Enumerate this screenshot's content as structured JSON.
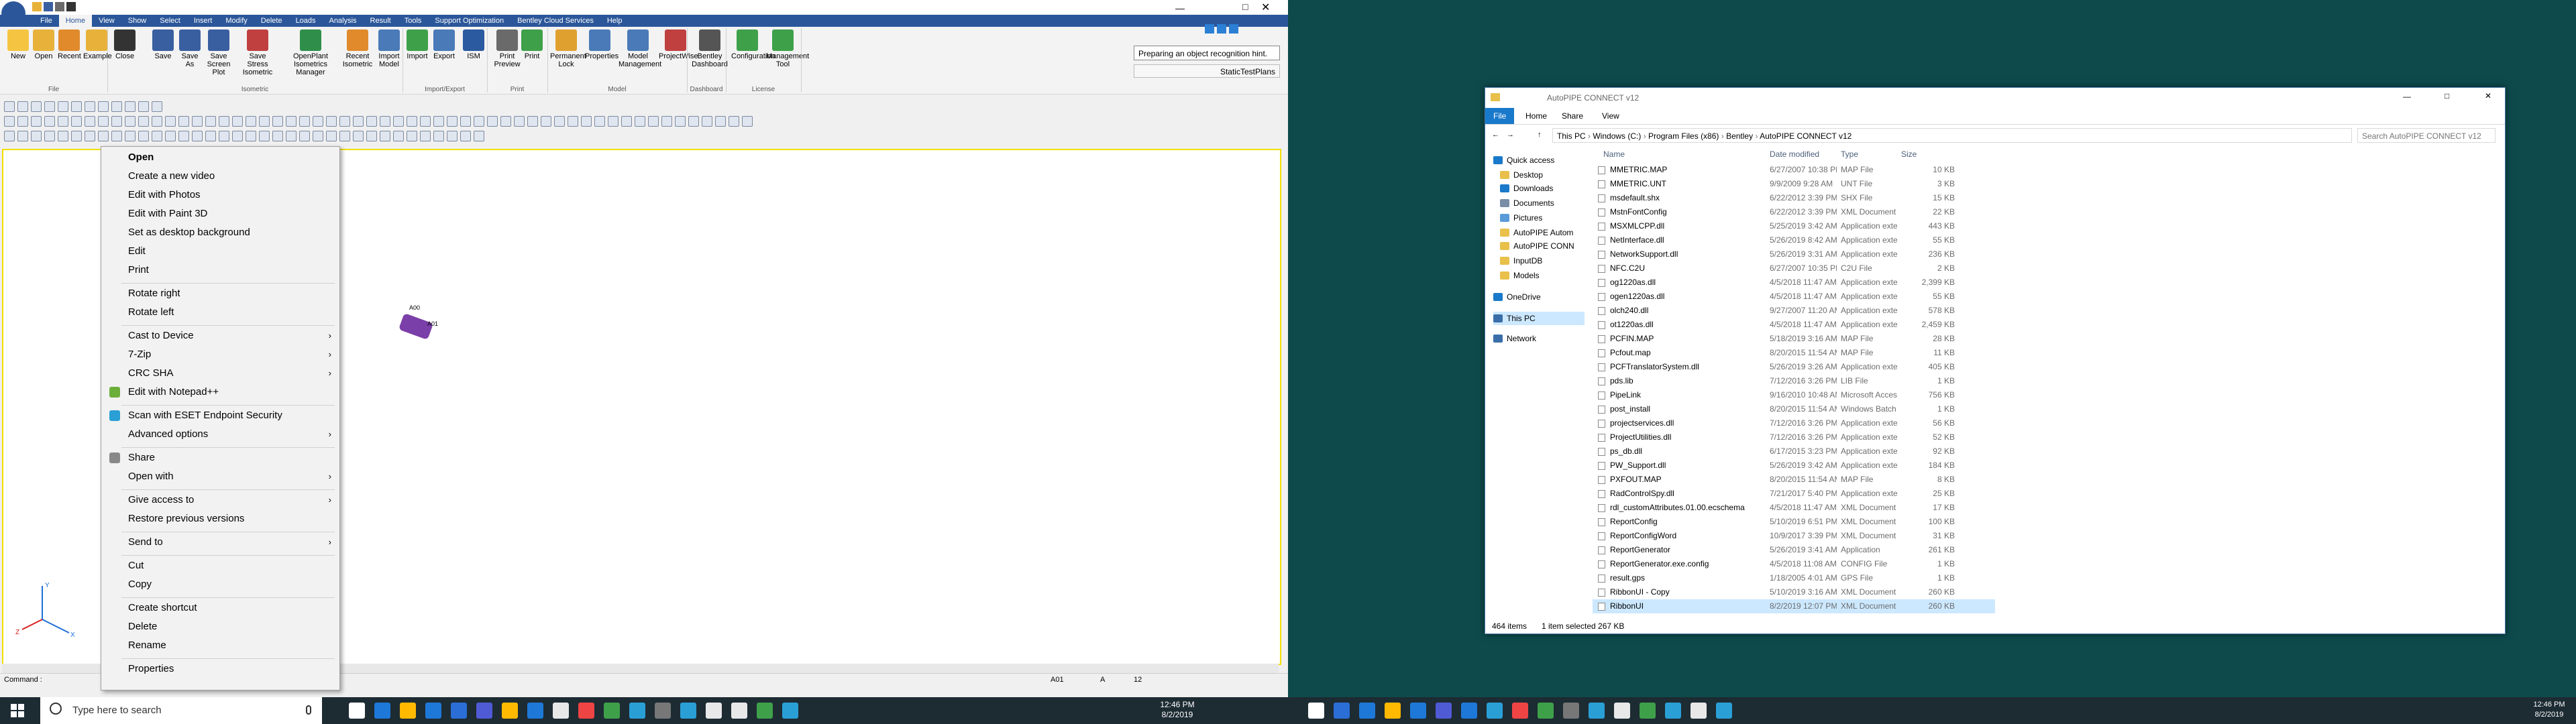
{
  "autopipe": {
    "tabs": [
      "File",
      "Home",
      "View",
      "Show",
      "Select",
      "Insert",
      "Modify",
      "Delete",
      "Loads",
      "Analysis",
      "Result",
      "Tools",
      "Support Optimization",
      "Bentley Cloud Services",
      "Help"
    ],
    "active_tab": "Home",
    "ribbon_buttons": [
      {
        "label": "New",
        "color": "#f5c542"
      },
      {
        "label": "Open",
        "color": "#e8b23a"
      },
      {
        "label": "Recent",
        "color": "#e08a2c"
      },
      {
        "label": "Example",
        "color": "#e8b23a"
      },
      {
        "label": "Close",
        "color": "#333333"
      },
      {
        "label": "Save",
        "color": "#3a5fa0"
      },
      {
        "label": "Save As",
        "color": "#3a5fa0"
      },
      {
        "label": "Save Screen Plot",
        "color": "#3a5fa0"
      },
      {
        "label": "Save Stress Isometric",
        "color": "#c04040"
      },
      {
        "label": "OpenPlant Isometrics Manager",
        "color": "#2f8f4a"
      },
      {
        "label": "Recent Isometric",
        "color": "#e08a2c"
      },
      {
        "label": "Import Model",
        "color": "#4a7ab8"
      },
      {
        "label": "Import",
        "color": "#3fa04a"
      },
      {
        "label": "Export",
        "color": "#4a7ab8"
      },
      {
        "label": "ISM",
        "color": "#2b5aa0"
      },
      {
        "label": "Print Preview",
        "color": "#6a6a6a"
      },
      {
        "label": "Print",
        "color": "#3fa04a"
      },
      {
        "label": "Permanent Lock",
        "color": "#e0a030"
      },
      {
        "label": "Properties",
        "color": "#4a7ab8"
      },
      {
        "label": "Model Management",
        "color": "#4a7ab8"
      },
      {
        "label": "ProjectWise",
        "color": "#c04040"
      },
      {
        "label": "Bentley Dashboard",
        "color": "#555555"
      },
      {
        "label": "Configuration",
        "color": "#3fa04a"
      },
      {
        "label": "Management Tool",
        "color": "#3fa04a"
      }
    ],
    "groups": [
      "File",
      "Isometric",
      "Import/Export",
      "Print",
      "Model",
      "Dashboard",
      "License"
    ],
    "hint_text": "Preparing an object recognition hint.",
    "hint_sub": "StaticTestPlans",
    "model_labels": {
      "node_a": "A00",
      "node_b": "A01"
    },
    "status": {
      "command": "Command :",
      "coord_a": "A01",
      "coord_b": "A",
      "coord_c": "12"
    }
  },
  "context_menu": {
    "items": [
      {
        "label": "Open",
        "bold": true
      },
      {
        "label": "Create a new video"
      },
      {
        "label": "Edit with Photos"
      },
      {
        "label": "Edit with Paint 3D"
      },
      {
        "label": "Set as desktop background"
      },
      {
        "label": "Edit"
      },
      {
        "label": "Print"
      },
      {
        "sep": true
      },
      {
        "label": "Rotate right"
      },
      {
        "label": "Rotate left"
      },
      {
        "sep": true
      },
      {
        "label": "Cast to Device",
        "submenu": true
      },
      {
        "label": "7-Zip",
        "submenu": true
      },
      {
        "label": "CRC SHA",
        "submenu": true
      },
      {
        "label": "Edit with Notepad++",
        "icon": "notepad-icon"
      },
      {
        "sep": true
      },
      {
        "label": "Scan with ESET Endpoint Security",
        "icon": "eset-icon"
      },
      {
        "label": "Advanced options",
        "submenu": true
      },
      {
        "sep": true
      },
      {
        "label": "Share",
        "icon": "share-icon"
      },
      {
        "label": "Open with",
        "submenu": true
      },
      {
        "sep": true
      },
      {
        "label": "Give access to",
        "submenu": true
      },
      {
        "label": "Restore previous versions"
      },
      {
        "sep": true
      },
      {
        "label": "Send to",
        "submenu": true
      },
      {
        "sep": true
      },
      {
        "label": "Cut"
      },
      {
        "label": "Copy"
      },
      {
        "sep": true
      },
      {
        "label": "Create shortcut"
      },
      {
        "label": "Delete"
      },
      {
        "label": "Rename"
      },
      {
        "sep": true
      },
      {
        "label": "Properties"
      }
    ]
  },
  "taskbar": {
    "search_placeholder": "Type here to search",
    "time": "12:46 PM",
    "date": "8/2/2019"
  },
  "explorer": {
    "title": "AutoPIPE CONNECT v12",
    "tabs": [
      "File",
      "Home",
      "Share",
      "View"
    ],
    "breadcrumb": [
      "This PC",
      "Windows (C:)",
      "Program Files (x86)",
      "Bentley",
      "AutoPIPE CONNECT v12"
    ],
    "search_placeholder": "Search AutoPIPE CONNECT v12",
    "columns": [
      "Name",
      "Date modified",
      "Type",
      "Size"
    ],
    "nav": [
      {
        "label": "Quick access",
        "icon": "star-icon"
      },
      {
        "label": "Desktop",
        "icon": "folder-icon"
      },
      {
        "label": "Downloads",
        "icon": "download-icon"
      },
      {
        "label": "Documents",
        "icon": "document-icon"
      },
      {
        "label": "Pictures",
        "icon": "picture-icon"
      },
      {
        "label": "AutoPIPE Autom",
        "icon": "folder-icon"
      },
      {
        "label": "AutoPIPE CONN",
        "icon": "folder-icon"
      },
      {
        "label": "InputDB",
        "icon": "folder-icon"
      },
      {
        "label": "Models",
        "icon": "folder-icon"
      },
      {
        "label": "OneDrive",
        "icon": "cloud-icon"
      },
      {
        "label": "This PC",
        "icon": "pc-icon"
      },
      {
        "label": "Network",
        "icon": "network-icon"
      }
    ],
    "files": [
      [
        "MMETRIC.MAP",
        "6/27/2007 10:38 PM",
        "MAP File",
        "10 KB"
      ],
      [
        "MMETRIC.UNT",
        "9/9/2009 9:28 AM",
        "UNT File",
        "3 KB"
      ],
      [
        "msdefault.shx",
        "6/22/2012 3:39 PM",
        "SHX File",
        "15 KB"
      ],
      [
        "MstnFontConfig",
        "6/22/2012 3:39 PM",
        "XML Document",
        "22 KB"
      ],
      [
        "MSXMLCPP.dll",
        "5/25/2019 3:42 AM",
        "Application exten...",
        "443 KB"
      ],
      [
        "NetInterface.dll",
        "5/26/2019 8:42 AM",
        "Application exten...",
        "55 KB"
      ],
      [
        "NetworkSupport.dll",
        "5/26/2019 3:31 AM",
        "Application exten...",
        "236 KB"
      ],
      [
        "NFC.C2U",
        "6/27/2007 10:35 PM",
        "C2U File",
        "2 KB"
      ],
      [
        "og1220as.dll",
        "4/5/2018 11:47 AM",
        "Application exten...",
        "2,399 KB"
      ],
      [
        "ogen1220as.dll",
        "4/5/2018 11:47 AM",
        "Application exten...",
        "55 KB"
      ],
      [
        "olch240.dll",
        "9/27/2007 11:20 AM",
        "Application exten...",
        "578 KB"
      ],
      [
        "ot1220as.dll",
        "4/5/2018 11:47 AM",
        "Application exten...",
        "2,459 KB"
      ],
      [
        "PCFIN.MAP",
        "5/18/2019 3:16 AM",
        "MAP File",
        "28 KB"
      ],
      [
        "Pcfout.map",
        "8/20/2015 11:54 AM",
        "MAP File",
        "11 KB"
      ],
      [
        "PCFTranslatorSystem.dll",
        "5/26/2019 3:26 AM",
        "Application exten...",
        "405 KB"
      ],
      [
        "pds.lib",
        "7/12/2016 3:26 PM",
        "LIB File",
        "1 KB"
      ],
      [
        "PipeLink",
        "9/16/2010 10:48 AM",
        "Microsoft Access ...",
        "756 KB"
      ],
      [
        "post_install",
        "8/20/2015 11:54 AM",
        "Windows Batch File",
        "1 KB"
      ],
      [
        "projectservices.dll",
        "7/12/2016 3:26 PM",
        "Application exten...",
        "56 KB"
      ],
      [
        "ProjectUtilities.dll",
        "7/12/2016 3:26 PM",
        "Application exten...",
        "52 KB"
      ],
      [
        "ps_db.dll",
        "6/17/2015 3:23 PM",
        "Application exten...",
        "92 KB"
      ],
      [
        "PW_Support.dll",
        "5/26/2019 3:42 AM",
        "Application exten...",
        "184 KB"
      ],
      [
        "PXFOUT.MAP",
        "8/20/2015 11:54 AM",
        "MAP File",
        "8 KB"
      ],
      [
        "RadControlSpy.dll",
        "7/21/2017 5:40 PM",
        "Application exten...",
        "25 KB"
      ],
      [
        "rdl_customAttributes.01.00.ecschema",
        "4/5/2018 11:47 AM",
        "XML Document",
        "17 KB"
      ],
      [
        "ReportConfig",
        "5/10/2019 6:51 PM",
        "XML Document",
        "100 KB"
      ],
      [
        "ReportConfigWord",
        "10/9/2017 3:39 PM",
        "XML Document",
        "31 KB"
      ],
      [
        "ReportGenerator",
        "5/26/2019 3:41 AM",
        "Application",
        "261 KB"
      ],
      [
        "ReportGenerator.exe.config",
        "4/5/2018 11:08 AM",
        "CONFIG File",
        "1 KB"
      ],
      [
        "result.gps",
        "1/18/2005 4:01 AM",
        "GPS File",
        "1 KB"
      ],
      [
        "RibbonUI - Copy",
        "5/10/2019 3:16 AM",
        "XML Document",
        "260 KB"
      ],
      [
        "RibbonUI",
        "8/2/2019 12:07 PM",
        "XML Document",
        "260 KB"
      ]
    ],
    "selected_index": 31,
    "status_count": "464 items",
    "status_selected": "1 item selected  267 KB"
  },
  "right_taskbar": {
    "time": "12:46 PM",
    "date": "8/2/2019"
  }
}
